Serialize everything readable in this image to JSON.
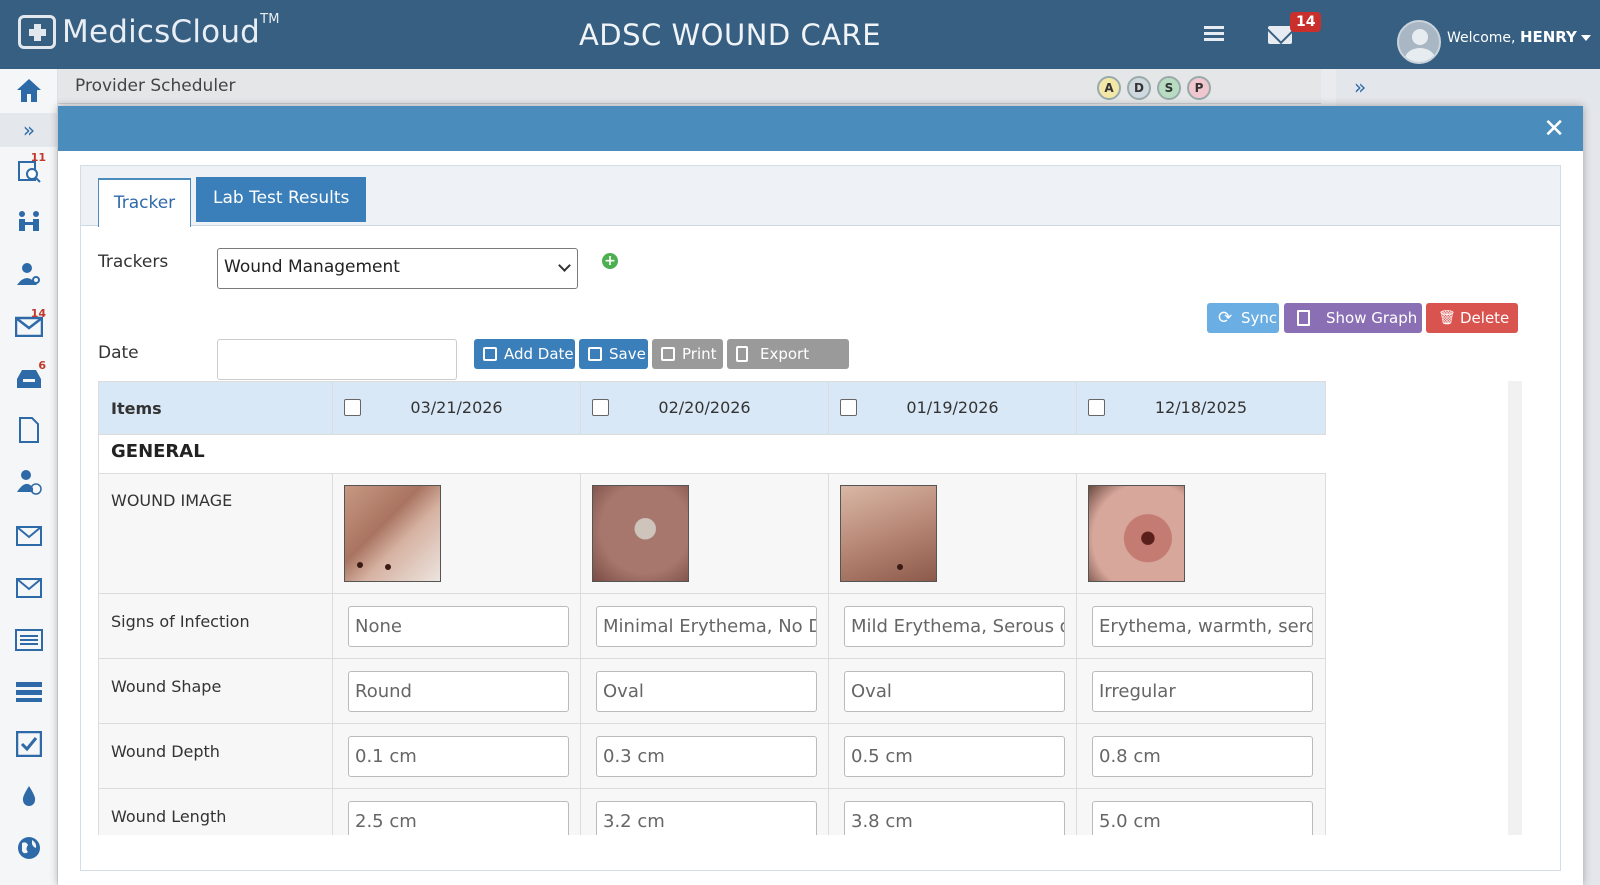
{
  "header": {
    "logo_text": "MedicsCloud",
    "logo_tm": "TM",
    "app_title": "ADSC WOUND CARE",
    "mail_count": "14",
    "welcome_prefix": "Welcome,",
    "user_name": "HENRY"
  },
  "sidebar": {
    "items": [
      {
        "icon": "home-icon"
      },
      {
        "icon": "search-list-icon",
        "badge": "11"
      },
      {
        "icon": "meeting-icon"
      },
      {
        "icon": "user-search-icon"
      },
      {
        "icon": "mail-icon",
        "badge": "14"
      },
      {
        "icon": "inbox-icon",
        "badge": "6"
      },
      {
        "icon": "document-icon"
      },
      {
        "icon": "user-check-icon"
      },
      {
        "icon": "envelope-icon"
      },
      {
        "icon": "envelope-icon"
      },
      {
        "icon": "list-icon"
      },
      {
        "icon": "server-icon"
      },
      {
        "icon": "checkbox-icon"
      },
      {
        "icon": "drop-icon"
      },
      {
        "icon": "globe-icon"
      }
    ]
  },
  "background": {
    "page_title": "Provider Scheduler",
    "status_circles": [
      "A",
      "D",
      "S",
      "P"
    ]
  },
  "modal": {
    "tabs": [
      {
        "label": "Tracker",
        "active": true
      },
      {
        "label": "Lab Test Results",
        "active": false
      }
    ],
    "trackers_label": "Trackers",
    "tracker_selected": "Wound Management",
    "date_label": "Date",
    "date_value": "",
    "buttons": {
      "add_date": "Add Date",
      "save": "Save",
      "print": "Print",
      "export_excel": "Export Excel",
      "sync": "Sync",
      "show_graph": "Show Graph",
      "delete": "Delete"
    },
    "grid": {
      "items_header": "Items",
      "dates": [
        "03/21/2026",
        "02/20/2026",
        "01/19/2026",
        "12/18/2025"
      ],
      "section": "GENERAL",
      "wound_image_label": "WOUND IMAGE",
      "rows": [
        {
          "label": "Signs of Infection",
          "values": [
            "None",
            "Minimal Erythema, No Drainage",
            "Mild Erythema, Serous drainage",
            "Erythema, warmth, serous drainage"
          ]
        },
        {
          "label": "Wound Shape",
          "values": [
            "Round",
            "Oval",
            "Oval",
            "Irregular"
          ]
        },
        {
          "label": "Wound Depth",
          "values": [
            "0.1 cm",
            "0.3 cm",
            "0.5 cm",
            "0.8 cm"
          ]
        },
        {
          "label": "Wound Length",
          "values": [
            "2.5 cm",
            "3.2 cm",
            "3.8 cm",
            "5.0 cm"
          ]
        }
      ]
    }
  },
  "colors": {
    "topbar": "#365f82",
    "modal_header": "#4a8dbd",
    "primary_button": "#3a7fba",
    "delete_button": "#d9534f",
    "graph_button": "#8b6fb5",
    "sync_button": "#6aaee3"
  }
}
